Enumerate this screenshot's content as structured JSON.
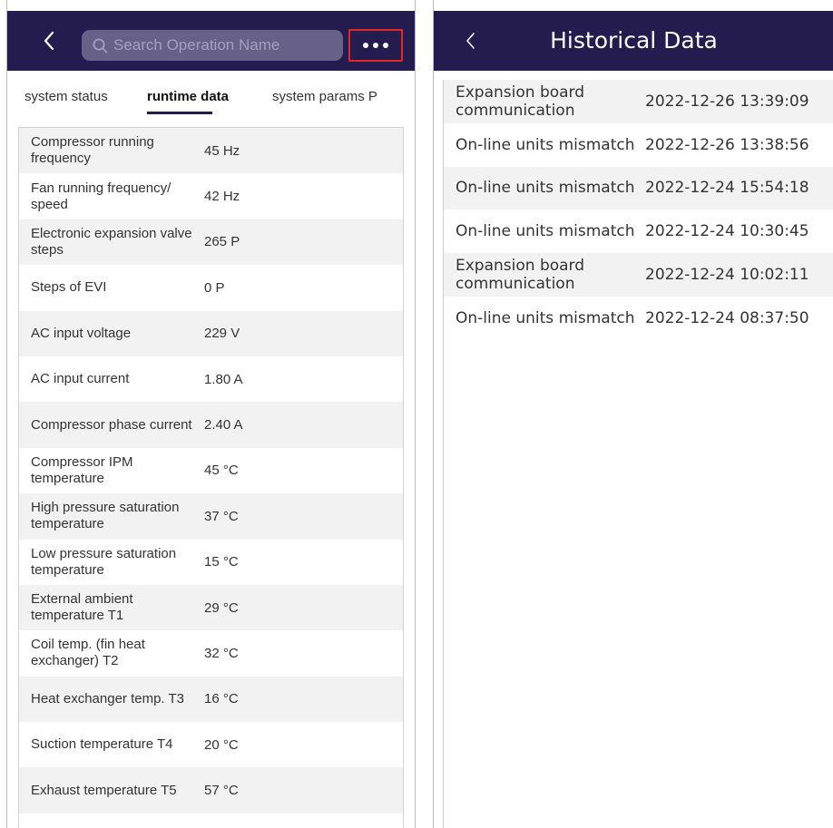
{
  "left": {
    "search": {
      "placeholder": "Search Operation Name"
    },
    "tabs": [
      {
        "label": "system status"
      },
      {
        "label": "runtime data"
      },
      {
        "label": "system params P"
      }
    ],
    "rows": [
      {
        "label": "Compressor running frequency",
        "value": "45 Hz"
      },
      {
        "label": "Fan running frequency/ speed",
        "value": "42 Hz"
      },
      {
        "label": "Electronic expansion valve steps",
        "value": "265 P"
      },
      {
        "label": "Steps of EVI",
        "value": "0 P"
      },
      {
        "label": "AC input voltage",
        "value": "229 V"
      },
      {
        "label": "AC input current",
        "value": "1.80 A"
      },
      {
        "label": "Compressor phase current",
        "value": "2.40 A"
      },
      {
        "label": "Compressor IPM temperature",
        "value": "45 °C"
      },
      {
        "label": "High pressure saturation temperature",
        "value": "37 °C"
      },
      {
        "label": "Low pressure saturation temperature",
        "value": "15 °C"
      },
      {
        "label": "External ambient temperature T1",
        "value": "29 °C"
      },
      {
        "label": "Coil temp. (fin heat exchanger) T2",
        "value": "32 °C"
      },
      {
        "label": "Heat exchanger temp. T3",
        "value": "16 °C"
      },
      {
        "label": "Suction temperature T4",
        "value": "20 °C"
      },
      {
        "label": "Exhaust temperature T5",
        "value": "57 °C"
      }
    ]
  },
  "right": {
    "title": "Historical Data",
    "rows": [
      {
        "label": "Expansion board communication",
        "time": "2022-12-26 13:39:09"
      },
      {
        "label": "On-line units mismatch",
        "time": "2022-12-26 13:38:56"
      },
      {
        "label": "On-line units mismatch",
        "time": "2022-12-24 15:54:18"
      },
      {
        "label": "On-line units mismatch",
        "time": "2022-12-24 10:30:45"
      },
      {
        "label": "Expansion board communication",
        "time": "2022-12-24 10:02:11"
      },
      {
        "label": "On-line units mismatch",
        "time": "2022-12-24 08:37:50"
      }
    ]
  },
  "colors": {
    "header": "#241c4e",
    "search_bg": "#676088",
    "highlight_border": "#e32626",
    "row_alt": "#f2f2f2"
  },
  "icons": {
    "back": "chevron-left-icon",
    "search": "search-icon",
    "more": "more-dots-icon"
  }
}
